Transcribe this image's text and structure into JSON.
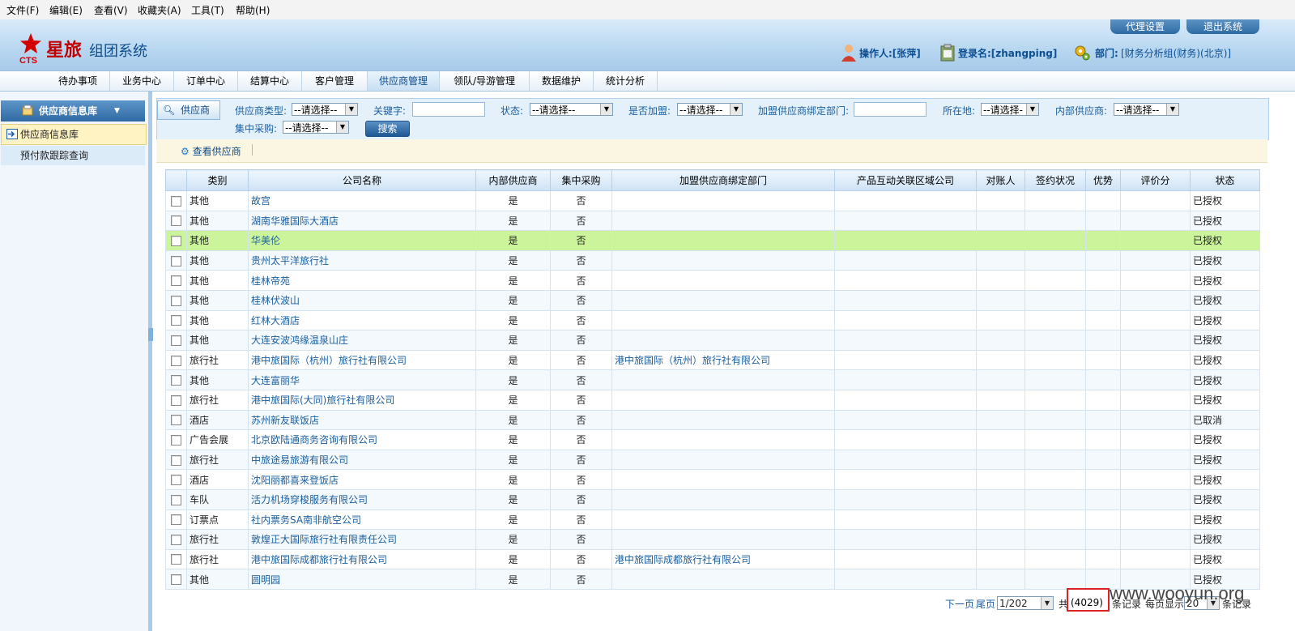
{
  "menubar": [
    "文件(F)",
    "编辑(E)",
    "查看(V)",
    "收藏夹(A)",
    "工具(T)",
    "帮助(H)"
  ],
  "header": {
    "logo_abbr": "CTS",
    "logo_name": "星旅",
    "system_name": "组团系统",
    "btn_agent": "代理设置",
    "btn_logout": "退出系统",
    "operator": "操作人:[张萍]",
    "login": "登录名:[zhangping]",
    "dept_label": "部门:",
    "dept_value": "[财务分析组(财务)(北京)]",
    "accent": "#c00000"
  },
  "nav": [
    "待办事项",
    "业务中心",
    "订单中心",
    "结算中心",
    "客户管理",
    "供应商管理",
    "领队/导游管理",
    "数据维护",
    "统计分析"
  ],
  "nav_active": "供应商管理",
  "sidebar": {
    "title": "供应商信息库",
    "items": [
      "供应商信息库",
      "预付款跟踪查询"
    ]
  },
  "filter": {
    "tab": "供应商",
    "type_label": "供应商类型:",
    "type_value": "--请选择--",
    "keyword_label": "关键字:",
    "keyword_value": "",
    "status_label": "状态:",
    "status_value": "--请选择--",
    "joined_label": "是否加盟:",
    "joined_value": "--请选择--",
    "dept_label": "加盟供应商绑定部门:",
    "dept_value": "",
    "location_label": "所在地:",
    "location_value": "--请选择-",
    "internal_label": "内部供应商:",
    "internal_value": "--请选择--",
    "central_label": "集中采购:",
    "central_value": "--请选择--",
    "search": "搜索"
  },
  "toolbar": {
    "view": "查看供应商"
  },
  "table": {
    "headers": [
      "类别",
      "公司名称",
      "内部供应商",
      "集中采购",
      "加盟供应商绑定部门",
      "产品互动关联区域公司",
      "对账人",
      "签约状况",
      "优势",
      "评价分",
      "状态"
    ],
    "rows": [
      [
        "其他",
        "故宫",
        "是",
        "否",
        "",
        "",
        "",
        "",
        "",
        "",
        "已授权"
      ],
      [
        "其他",
        "湖南华雅国际大酒店",
        "是",
        "否",
        "",
        "",
        "",
        "",
        "",
        "",
        "已授权"
      ],
      [
        "其他",
        "华美伦",
        "是",
        "否",
        "",
        "",
        "",
        "",
        "",
        "",
        "已授权"
      ],
      [
        "其他",
        "贵州太平洋旅行社",
        "是",
        "否",
        "",
        "",
        "",
        "",
        "",
        "",
        "已授权"
      ],
      [
        "其他",
        "桂林帝苑",
        "是",
        "否",
        "",
        "",
        "",
        "",
        "",
        "",
        "已授权"
      ],
      [
        "其他",
        "桂林伏波山",
        "是",
        "否",
        "",
        "",
        "",
        "",
        "",
        "",
        "已授权"
      ],
      [
        "其他",
        "红林大酒店",
        "是",
        "否",
        "",
        "",
        "",
        "",
        "",
        "",
        "已授权"
      ],
      [
        "其他",
        "大连安波鸿缘温泉山庄",
        "是",
        "否",
        "",
        "",
        "",
        "",
        "",
        "",
        "已授权"
      ],
      [
        "旅行社",
        "港中旅国际（杭州）旅行社有限公司",
        "是",
        "否",
        "港中旅国际（杭州）旅行社有限公司",
        "",
        "",
        "",
        "",
        "",
        "已授权"
      ],
      [
        "其他",
        "大连富丽华",
        "是",
        "否",
        "",
        "",
        "",
        "",
        "",
        "",
        "已授权"
      ],
      [
        "旅行社",
        "港中旅国际(大同)旅行社有限公司",
        "是",
        "否",
        "",
        "",
        "",
        "",
        "",
        "",
        "已授权"
      ],
      [
        "酒店",
        "苏州新友联饭店",
        "是",
        "否",
        "",
        "",
        "",
        "",
        "",
        "",
        "已取消"
      ],
      [
        "广告会展",
        "北京欧陆通商务咨询有限公司",
        "是",
        "否",
        "",
        "",
        "",
        "",
        "",
        "",
        "已授权"
      ],
      [
        "旅行社",
        "中旅途易旅游有限公司",
        "是",
        "否",
        "",
        "",
        "",
        "",
        "",
        "",
        "已授权"
      ],
      [
        "酒店",
        "沈阳丽都喜来登饭店",
        "是",
        "否",
        "",
        "",
        "",
        "",
        "",
        "",
        "已授权"
      ],
      [
        "车队",
        "活力机场穿梭服务有限公司",
        "是",
        "否",
        "",
        "",
        "",
        "",
        "",
        "",
        "已授权"
      ],
      [
        "订票点",
        "社内票务SA南非航空公司",
        "是",
        "否",
        "",
        "",
        "",
        "",
        "",
        "",
        "已授权"
      ],
      [
        "旅行社",
        "敦煌正大国际旅行社有限责任公司",
        "是",
        "否",
        "",
        "",
        "",
        "",
        "",
        "",
        "已授权"
      ],
      [
        "旅行社",
        "港中旅国际成都旅行社有限公司",
        "是",
        "否",
        "港中旅国际成都旅行社有限公司",
        "",
        "",
        "",
        "",
        "",
        "已授权"
      ],
      [
        "其他",
        "圆明园",
        "是",
        "否",
        "",
        "",
        "",
        "",
        "",
        "",
        "已授权"
      ]
    ],
    "highlight_row": 2
  },
  "pager": {
    "next": "下一页",
    "last": "尾页",
    "page": "1/202",
    "total_prefix": "共",
    "total": "(4029)",
    "total_suffix": "条记录",
    "per_page_label": "每页显示",
    "per_page": "20",
    "per_page_suffix": "条记录"
  },
  "watermark": "www.wooyun.org"
}
